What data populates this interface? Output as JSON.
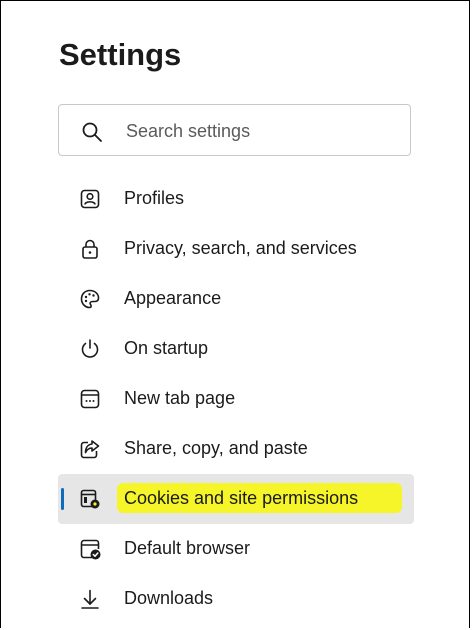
{
  "header": {
    "title": "Settings"
  },
  "search": {
    "placeholder": "Search settings",
    "icon": "search-icon"
  },
  "nav": {
    "items": [
      {
        "label": "Profiles",
        "icon": "profile-icon"
      },
      {
        "label": "Privacy, search, and services",
        "icon": "lock-icon"
      },
      {
        "label": "Appearance",
        "icon": "palette-icon"
      },
      {
        "label": "On startup",
        "icon": "power-icon"
      },
      {
        "label": "New tab page",
        "icon": "new-tab-icon"
      },
      {
        "label": "Share, copy, and paste",
        "icon": "share-icon"
      },
      {
        "label": "Cookies and site permissions",
        "icon": "cookies-settings-icon",
        "selected": true
      },
      {
        "label": "Default browser",
        "icon": "default-browser-icon"
      },
      {
        "label": "Downloads",
        "icon": "download-icon"
      }
    ]
  },
  "colors": {
    "accent": "#0f6cbd",
    "highlight": "#f5f52a",
    "selected_bg": "#e6e6e6"
  }
}
